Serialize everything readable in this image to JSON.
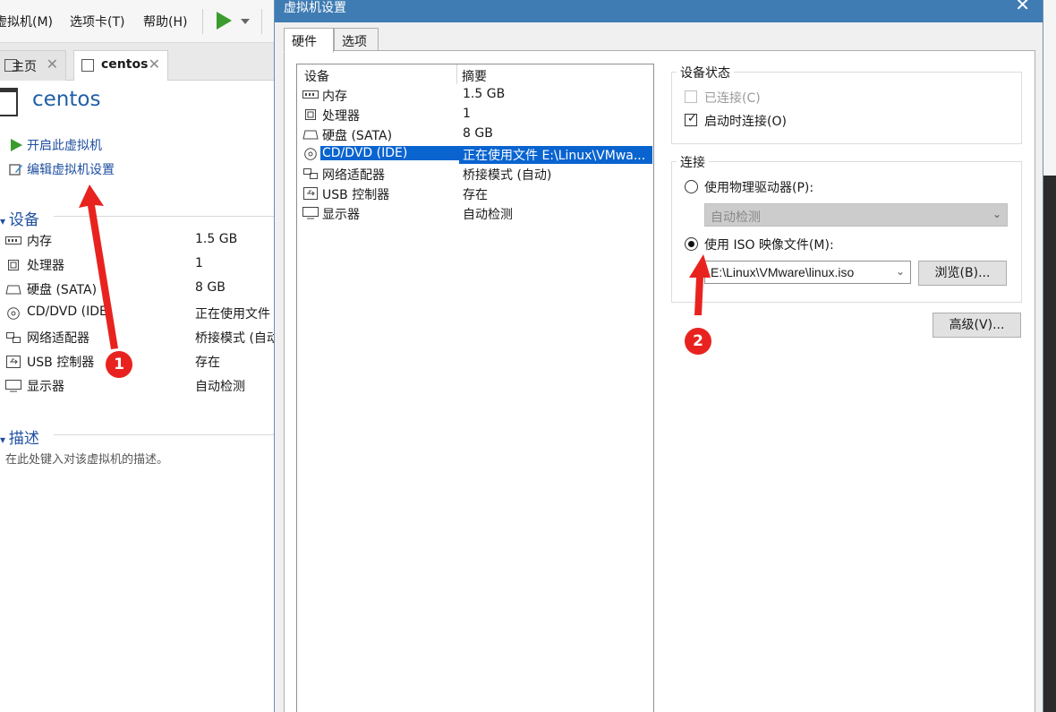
{
  "menubar": {
    "items": [
      "虚拟机(M)",
      "选项卡(T)",
      "帮助(H)"
    ]
  },
  "tabs": [
    {
      "label": "主页"
    },
    {
      "label": "centos"
    }
  ],
  "vm": {
    "title": "centos",
    "actions": [
      "开启此虚拟机",
      "编辑虚拟机设置"
    ]
  },
  "devices_section": {
    "heading": "设备",
    "rows": [
      {
        "name": "内存",
        "value": "1.5 GB",
        "icon": "memory-icon"
      },
      {
        "name": "处理器",
        "value": "1",
        "icon": "processor-icon"
      },
      {
        "name": "硬盘 (SATA)",
        "value": "8 GB",
        "icon": "harddisk-icon"
      },
      {
        "name": "CD/DVD (IDE)",
        "value": "正在使用文件",
        "icon": "cdrom-icon"
      },
      {
        "name": "网络适配器",
        "value": "桥接模式 (自动",
        "icon": "network-icon"
      },
      {
        "name": "USB 控制器",
        "value": "存在",
        "icon": "usb-icon"
      },
      {
        "name": "显示器",
        "value": "自动检测",
        "icon": "monitor-icon"
      }
    ]
  },
  "description_section": {
    "heading": "描述",
    "placeholder": "在此处键入对该虚拟机的描述。"
  },
  "dialog": {
    "title": "虚拟机设置",
    "tabs": [
      "硬件",
      "选项"
    ],
    "device_list": {
      "columns": [
        "设备",
        "摘要"
      ],
      "rows": [
        {
          "name": "内存",
          "value": "1.5 GB"
        },
        {
          "name": "处理器",
          "value": "1"
        },
        {
          "name": "硬盘 (SATA)",
          "value": "8 GB"
        },
        {
          "name": "CD/DVD (IDE)",
          "value": "正在使用文件 E:\\Linux\\VMwa...",
          "selected": true
        },
        {
          "name": "网络适配器",
          "value": "桥接模式 (自动)"
        },
        {
          "name": "USB 控制器",
          "value": "存在"
        },
        {
          "name": "显示器",
          "value": "自动检测"
        }
      ]
    },
    "device_status": {
      "title": "设备状态",
      "connected": {
        "label": "已连接(C)",
        "checked": false,
        "disabled": true
      },
      "connect_at_power_on": {
        "label": "启动时连接(O)",
        "checked": true
      }
    },
    "connection": {
      "title": "连接",
      "physical_drive": {
        "label": "使用物理驱动器(P):",
        "selected": false
      },
      "physical_drive_combo": "自动检测",
      "iso_image": {
        "label": "使用 ISO 映像文件(M):",
        "selected": true
      },
      "iso_path": "E:\\Linux\\VMware\\linux.iso",
      "browse_label": "浏览(B)..."
    },
    "advanced_label": "高级(V)..."
  },
  "annotations": {
    "badge1": "1",
    "badge2": "2",
    "color": "#e8231f"
  }
}
